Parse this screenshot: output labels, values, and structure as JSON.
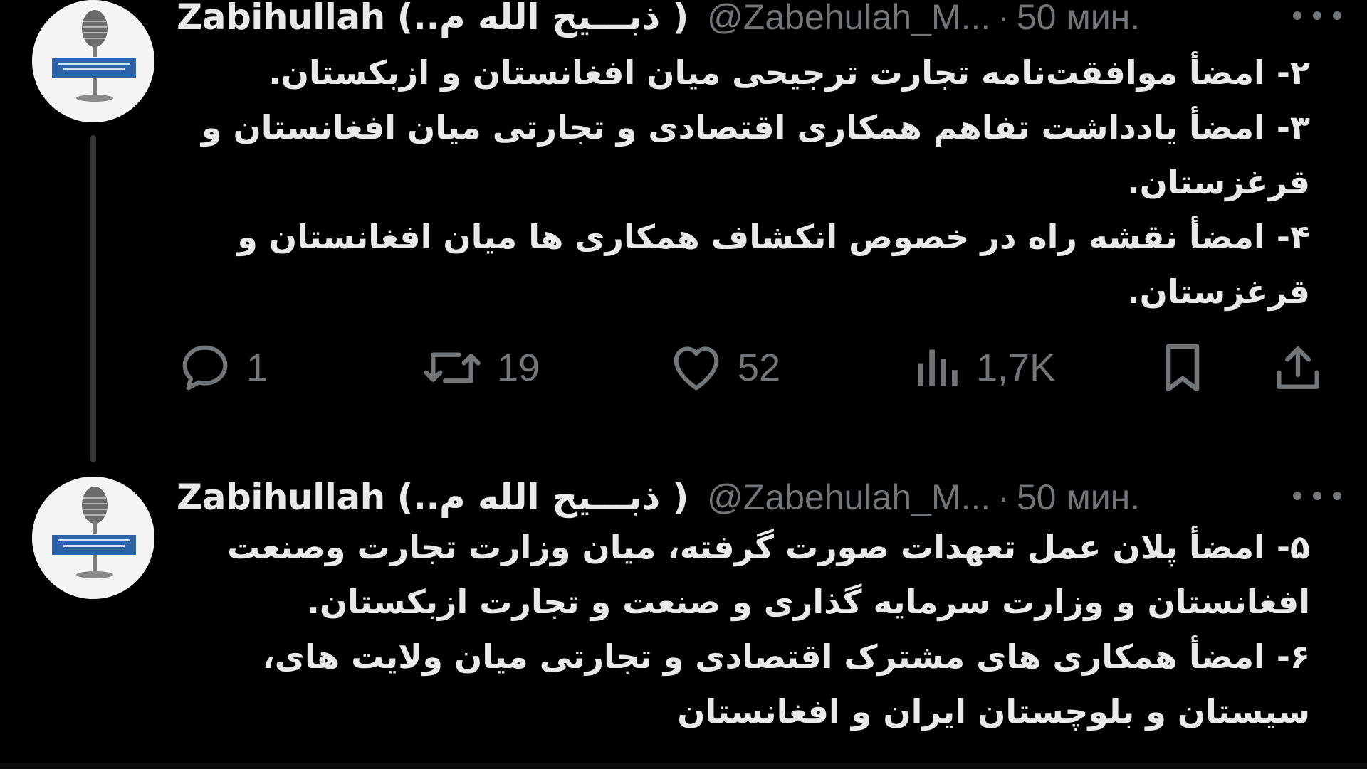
{
  "tweets": [
    {
      "display_name": "Zabihullah (..ذبـــیح الله م )",
      "handle": "@Zabehulah_M...",
      "separator": "·",
      "time": "50 мин.",
      "lines": [
        "۲- امضأ موافقت‌نامه تجارت ترجیحی میان افغانستان و ازبکستان.",
        "۳- امضأ یادداشت تفاهم همکاری اقتصادی و تجارتی میان افغانستان و قرغزستان.",
        "۴- امضأ نقشه راه در خصوص انکشاف همکاری ها میان افغانستان و قرغزستان."
      ],
      "actions": {
        "replies": "1",
        "retweets": "19",
        "likes": "52",
        "views": "1,7K"
      }
    },
    {
      "display_name": "Zabihullah (..ذبـــیح الله م )",
      "handle": "@Zabehulah_M...",
      "separator": "·",
      "time": "50 мин.",
      "lines": [
        "۵- امضأ پلان عمل تعهدات صورت گرفته، میان وزارت تجارت وصنعت افغانستان و وزارت سرمایه گذاری و صنعت و تجارت ازبکستان.",
        "۶- امضأ همکاری های مشترک اقتصادی و تجارتی میان ولایت های، سیستان و بلوچستان ایران و افغانستان"
      ]
    }
  ],
  "icons": {
    "avatar": "microphone-logo-icon",
    "more": "more-dots-icon",
    "reply": "reply-icon",
    "retweet": "retweet-icon",
    "like": "heart-icon",
    "views": "views-chart-icon",
    "bookmark": "bookmark-icon",
    "share": "share-icon"
  },
  "colors": {
    "background": "#000000",
    "text_primary": "#e7e9ea",
    "text_secondary": "#71767b",
    "thread_line": "#333639"
  }
}
